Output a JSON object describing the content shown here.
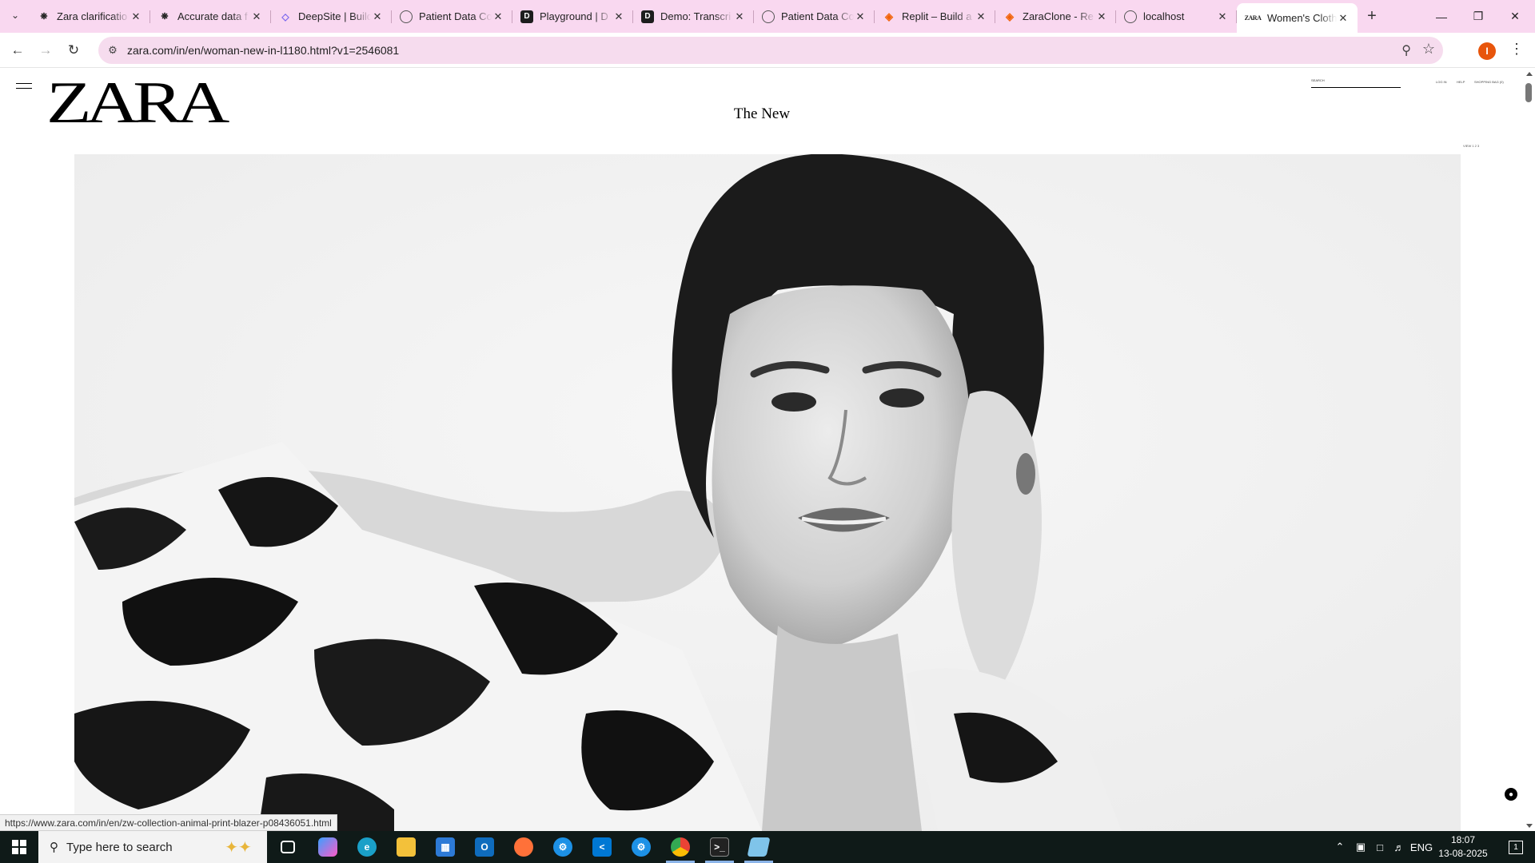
{
  "browser": {
    "tabs": [
      {
        "title": "Zara clarificatio",
        "favicon": "openai-icon",
        "active": false
      },
      {
        "title": "Accurate data f",
        "favicon": "openai-icon",
        "active": false
      },
      {
        "title": "DeepSite | Build",
        "favicon": "deepsite-icon",
        "active": false
      },
      {
        "title": "Patient Data Co",
        "favicon": "globe-icon",
        "active": false
      },
      {
        "title": "Playground | D",
        "favicon": "deepgram-icon",
        "active": false
      },
      {
        "title": "Demo: Transcri",
        "favicon": "deepgram-icon",
        "active": false
      },
      {
        "title": "Patient Data Co",
        "favicon": "globe-icon",
        "active": false
      },
      {
        "title": "Replit – Build a",
        "favicon": "replit-icon",
        "active": false
      },
      {
        "title": "ZaraClone - Re",
        "favicon": "replit-icon",
        "active": false
      },
      {
        "title": "localhost",
        "favicon": "globe-icon",
        "active": false
      },
      {
        "title": "Women's Cloth",
        "favicon": "zara-icon",
        "favicon_text": "ZARA",
        "active": true
      }
    ],
    "url": "zara.com/in/en/woman-new-in-l1180.html?v1=2546081",
    "profile_initial": "I",
    "status_url": "https://www.zara.com/in/en/zw-collection-animal-print-blazer-p08436051.html"
  },
  "page": {
    "logo": "ZARA",
    "title": "The New",
    "search_label": "SEARCH",
    "top_links": [
      "LOG IN",
      "HELP",
      "SHOPPING BAG (0)"
    ],
    "view_links": "VIEW  1  2  3"
  },
  "taskbar": {
    "search_placeholder": "Type here to search",
    "language": "ENG",
    "time": "18:07",
    "date": "13-08-2025",
    "notification_count": "1"
  },
  "colors": {
    "tabstrip": "#f9d8f0",
    "omnibox": "#f6dcee",
    "taskbar": "#0f1a18",
    "profile": "#e8550b"
  }
}
